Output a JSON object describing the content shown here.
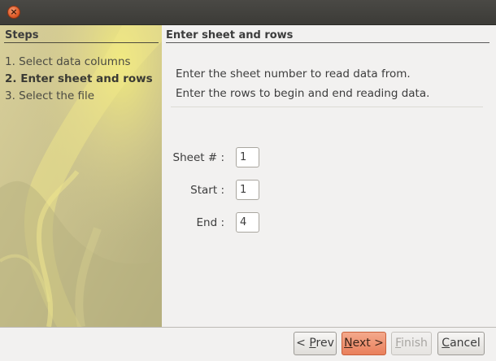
{
  "window": {
    "close_glyph": "×",
    "close_color": "#e05b28"
  },
  "steps": {
    "header": "Steps",
    "items": [
      {
        "label": "1. Select data columns",
        "active": false
      },
      {
        "label": "2. Enter sheet and rows",
        "active": true
      },
      {
        "label": "3. Select the file",
        "active": false
      }
    ]
  },
  "content": {
    "header": "Enter sheet and rows",
    "description_lines": [
      "Enter the sheet number to read data from.",
      "Enter the rows to begin and end reading data."
    ],
    "fields": [
      {
        "label": "Sheet # :",
        "value": "1"
      },
      {
        "label": "Start :",
        "value": "1"
      },
      {
        "label": "End :",
        "value": "4"
      }
    ]
  },
  "buttons": {
    "prev": {
      "prefix": "< ",
      "mnemonic": "P",
      "rest": "rev"
    },
    "next": {
      "mnemonic": "N",
      "rest": "ext >"
    },
    "finish": {
      "mnemonic": "F",
      "rest": "inish"
    },
    "cancel": {
      "mnemonic": "C",
      "rest": "ancel"
    },
    "accent_color": "#e9805c"
  }
}
